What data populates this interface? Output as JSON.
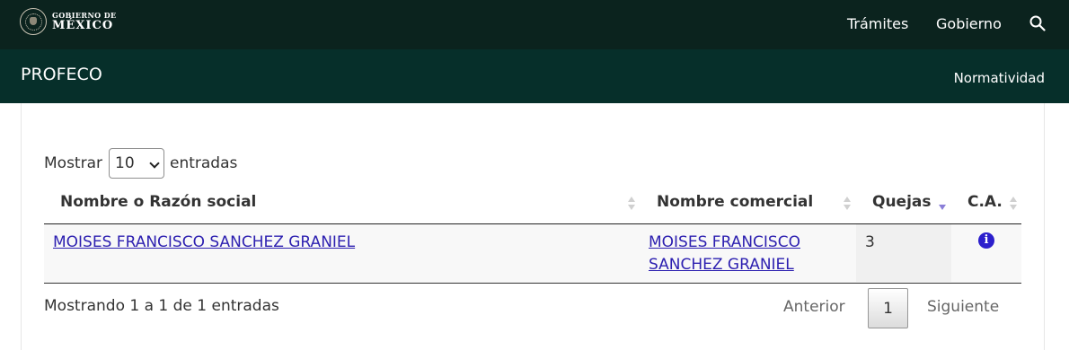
{
  "header": {
    "logo": {
      "line1": "GOBIERNO DE",
      "line2": "MÉXICO",
      "icon": "mexico-seal-icon"
    },
    "nav": [
      "Trámites",
      "Gobierno"
    ],
    "search_icon": "search-icon",
    "background": "#0b231e"
  },
  "subheader": {
    "title": "PROFECO",
    "link": "Normatividad",
    "background": "#062f2a"
  },
  "table_controls": {
    "show_label": "Mostrar",
    "page_length": "10",
    "entries_label": "entradas"
  },
  "table": {
    "columns": [
      "Nombre o Razón social",
      "Nombre comercial",
      "Quejas",
      "C.A."
    ],
    "sorted_column": "Quejas",
    "sort_direction": "descending",
    "rows": [
      {
        "razon_social": "MOISES FRANCISCO SANCHEZ GRANIEL",
        "nombre_comercial": "MOISES FRANCISCO SANCHEZ GRANIEL",
        "quejas": "3",
        "ca_icon": "info-circle-icon"
      }
    ]
  },
  "footer": {
    "info": "Mostrando 1 a 1 de 1 entradas",
    "prev": "Anterior",
    "page": "1",
    "next": "Siguiente"
  },
  "colors": {
    "link": "#2c1fb0",
    "sort_active": "#8a7ed8",
    "info_icon": "#2c1fcc"
  }
}
